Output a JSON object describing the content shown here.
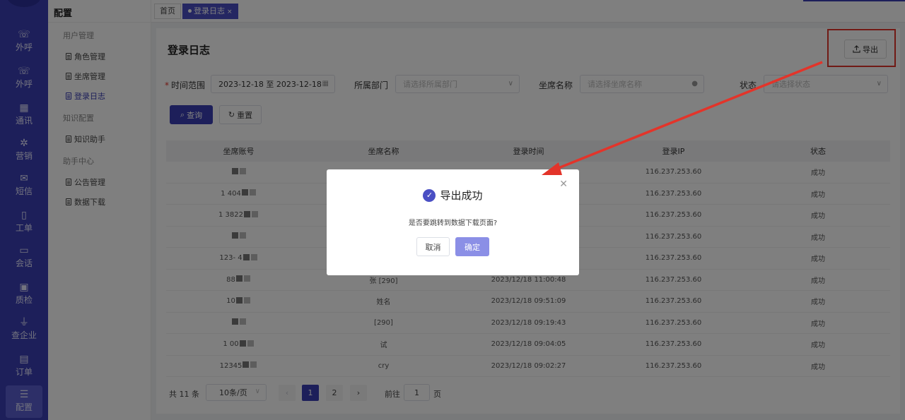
{
  "nav": {
    "items": [
      {
        "label": "外呼",
        "icon": "phone-out-icon"
      },
      {
        "label": "外呼",
        "icon": "phone-out-icon"
      },
      {
        "label": "通讯",
        "icon": "contacts-icon"
      },
      {
        "label": "营销",
        "icon": "marketing-icon"
      },
      {
        "label": "短信",
        "icon": "sms-icon"
      },
      {
        "label": "工单",
        "icon": "ticket-icon"
      },
      {
        "label": "会话",
        "icon": "chat-icon"
      },
      {
        "label": "质检",
        "icon": "quality-icon"
      },
      {
        "label": "查企业",
        "icon": "company-icon"
      },
      {
        "label": "订单",
        "icon": "order-icon"
      },
      {
        "label": "配置",
        "icon": "settings-icon"
      }
    ]
  },
  "submenu": {
    "title": "配置",
    "groups": [
      {
        "label": "用户管理",
        "items": [
          "角色管理",
          "坐席管理",
          "登录日志"
        ]
      },
      {
        "label": "知识配置",
        "items": [
          "知识助手"
        ]
      },
      {
        "label": "助手中心",
        "items": [
          "公告管理",
          "数据下载"
        ]
      }
    ]
  },
  "tabs": {
    "home": "首页",
    "current": "登录日志",
    "close": "×"
  },
  "page": {
    "title": "登录日志",
    "export_label": "导出"
  },
  "filters": {
    "time_label": "时间范围",
    "time_value": "2023-12-18 至 2023-12-18",
    "dept_label": "所属部门",
    "dept_placeholder": "请选择所属部门",
    "agent_label": "坐席名称",
    "agent_placeholder": "请选择坐席名称",
    "status_label": "状态",
    "status_placeholder": "请选择状态",
    "query_label": "查询",
    "reset_label": "重置"
  },
  "table": {
    "headers": [
      "坐席账号",
      "坐席名称",
      "登录时间",
      "登录IP",
      "状态"
    ],
    "rows": [
      {
        "account": "",
        "name": "",
        "time": "",
        "ip": "116.237.253.60",
        "status": "成功"
      },
      {
        "account": "1    404",
        "name": "",
        "time": "",
        "ip": "116.237.253.60",
        "status": "成功"
      },
      {
        "account": "1   3822",
        "name": "",
        "time": "",
        "ip": "116.237.253.60",
        "status": "成功"
      },
      {
        "account": "",
        "name": "",
        "time": "",
        "ip": "116.237.253.60",
        "status": "成功"
      },
      {
        "account": "123-   4",
        "name": "",
        "time": "",
        "ip": "116.237.253.60",
        "status": "成功"
      },
      {
        "account": "88",
        "name": "张  [290]",
        "time": "2023/12/18 11:00:48",
        "ip": "116.237.253.60",
        "status": "成功"
      },
      {
        "account": "10",
        "name": "姓名",
        "time": "2023/12/18 09:51:09",
        "ip": "116.237.253.60",
        "status": "成功"
      },
      {
        "account": "",
        "name": "[290]",
        "time": "2023/12/18 09:19:43",
        "ip": "116.237.253.60",
        "status": "成功"
      },
      {
        "account": "1    00",
        "name": "试",
        "time": "2023/12/18 09:04:05",
        "ip": "116.237.253.60",
        "status": "成功"
      },
      {
        "account": "12345",
        "name": "cry",
        "time": "2023/12/18 09:02:27",
        "ip": "116.237.253.60",
        "status": "成功"
      }
    ]
  },
  "pagination": {
    "total": "共 11 条",
    "page_size": "10条/页",
    "pages": [
      "1",
      "2"
    ],
    "goto_label": "前往",
    "goto_value": "1",
    "unit": "页"
  },
  "dialog": {
    "title": "导出成功",
    "message": "是否要跳转到数据下载页面?",
    "cancel": "取消",
    "confirm": "确定"
  },
  "colors": {
    "primary": "#3b3fb4",
    "annotation": "#e3342a"
  }
}
